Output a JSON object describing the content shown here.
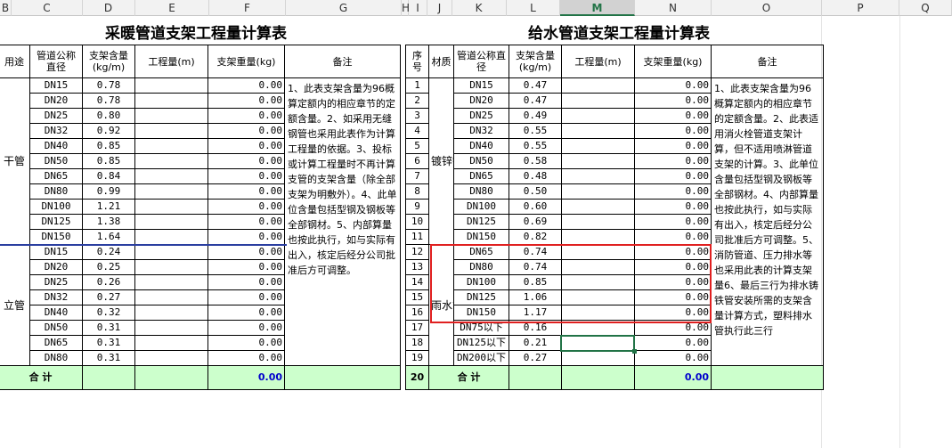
{
  "column_headers": [
    "B",
    "C",
    "D",
    "E",
    "F",
    "G",
    "H",
    "I",
    "J",
    "K",
    "L",
    "M",
    "N",
    "O",
    "P",
    "Q"
  ],
  "selected_column": "M",
  "left_table": {
    "title": "采暖管道支架工程量计算表",
    "headers": [
      "用途",
      "管道公称直径",
      "支架含量(kg/m)",
      "工程量(m)",
      "支架重量(kg)",
      "备注"
    ],
    "group1": "干管",
    "group2": "立管",
    "rows": [
      {
        "size": "DN15",
        "rate": "0.78",
        "qty": "",
        "weight": "0.00"
      },
      {
        "size": "DN20",
        "rate": "0.78",
        "qty": "",
        "weight": "0.00"
      },
      {
        "size": "DN25",
        "rate": "0.80",
        "qty": "",
        "weight": "0.00"
      },
      {
        "size": "DN32",
        "rate": "0.92",
        "qty": "",
        "weight": "0.00"
      },
      {
        "size": "DN40",
        "rate": "0.85",
        "qty": "",
        "weight": "0.00"
      },
      {
        "size": "DN50",
        "rate": "0.85",
        "qty": "",
        "weight": "0.00"
      },
      {
        "size": "DN65",
        "rate": "0.84",
        "qty": "",
        "weight": "0.00"
      },
      {
        "size": "DN80",
        "rate": "0.99",
        "qty": "",
        "weight": "0.00"
      },
      {
        "size": "DN100",
        "rate": "1.21",
        "qty": "",
        "weight": "0.00"
      },
      {
        "size": "DN125",
        "rate": "1.38",
        "qty": "",
        "weight": "0.00"
      },
      {
        "size": "DN150",
        "rate": "1.64",
        "qty": "",
        "weight": "0.00"
      },
      {
        "size": "DN15",
        "rate": "0.24",
        "qty": "",
        "weight": "0.00"
      },
      {
        "size": "DN20",
        "rate": "0.25",
        "qty": "",
        "weight": "0.00"
      },
      {
        "size": "DN25",
        "rate": "0.26",
        "qty": "",
        "weight": "0.00"
      },
      {
        "size": "DN32",
        "rate": "0.27",
        "qty": "",
        "weight": "0.00"
      },
      {
        "size": "DN40",
        "rate": "0.32",
        "qty": "",
        "weight": "0.00"
      },
      {
        "size": "DN50",
        "rate": "0.31",
        "qty": "",
        "weight": "0.00"
      },
      {
        "size": "DN65",
        "rate": "0.31",
        "qty": "",
        "weight": "0.00"
      },
      {
        "size": "DN80",
        "rate": "0.31",
        "qty": "",
        "weight": "0.00"
      }
    ],
    "notes": "1、此表支架含量为96概算定额内的相应章节的定额含量。2、如采用无缝钢管也采用此表作为计算工程量的依据。3、投标或计算工程量时不再计算支管的支架含量（除全部支架为明敷外）。4、此单位含量包括型钢及钢板等全部钢材。5、内部算量也按此执行，如与实际有出入，核定后经分公司批准后方可调整。",
    "total_label": "合    计",
    "total_value": "0.00"
  },
  "right_table": {
    "title": "给水管道支架工程量计算表",
    "headers": [
      "序号",
      "材质",
      "管道公称直径",
      "支架含量(kg/m)",
      "工程量(m)",
      "支架重量(kg)",
      "备注"
    ],
    "material1": "镀锌钢管（或其它钢管）",
    "material2": "雨水管",
    "rows": [
      {
        "no": "1",
        "size": "DN15",
        "rate": "0.47",
        "weight": "0.00"
      },
      {
        "no": "2",
        "size": "DN20",
        "rate": "0.47",
        "weight": "0.00"
      },
      {
        "no": "3",
        "size": "DN25",
        "rate": "0.49",
        "weight": "0.00"
      },
      {
        "no": "4",
        "size": "DN32",
        "rate": "0.55",
        "weight": "0.00"
      },
      {
        "no": "5",
        "size": "DN40",
        "rate": "0.55",
        "weight": "0.00"
      },
      {
        "no": "6",
        "size": "DN50",
        "rate": "0.58",
        "weight": "0.00"
      },
      {
        "no": "7",
        "size": "DN65",
        "rate": "0.48",
        "weight": "0.00"
      },
      {
        "no": "8",
        "size": "DN80",
        "rate": "0.50",
        "weight": "0.00"
      },
      {
        "no": "9",
        "size": "DN100",
        "rate": "0.60",
        "weight": "0.00"
      },
      {
        "no": "10",
        "size": "DN125",
        "rate": "0.69",
        "weight": "0.00"
      },
      {
        "no": "11",
        "size": "DN150",
        "rate": "0.82",
        "weight": "0.00"
      },
      {
        "no": "12",
        "size": "DN65",
        "rate": "0.74",
        "weight": "0.00"
      },
      {
        "no": "13",
        "size": "DN80",
        "rate": "0.74",
        "weight": "0.00"
      },
      {
        "no": "14",
        "size": "DN100",
        "rate": "0.85",
        "weight": "0.00"
      },
      {
        "no": "15",
        "size": "DN125",
        "rate": "1.06",
        "weight": "0.00"
      },
      {
        "no": "16",
        "size": "DN150",
        "rate": "1.17",
        "weight": "0.00"
      },
      {
        "no": "17",
        "size": "DN75以下",
        "rate": "0.16",
        "weight": "0.00"
      },
      {
        "no": "18",
        "size": "DN125以下",
        "rate": "0.21",
        "weight": "0.00"
      },
      {
        "no": "19",
        "size": "DN200以下",
        "rate": "0.27",
        "weight": "0.00"
      }
    ],
    "notes": "1、此表支架含量为96概算定额内的相应章节的定额含量。2、此表适用消火栓管道支架计算，但不适用喷淋管道支架的计算。3、此单位含量包括型钢及钢板等全部钢材。4、内部算量也按此执行，如与实际有出入，核定后经分公司批准后方可调整。5、消防管道、压力排水等也采用此表的计算支架量6、最后三行为排水铸铁管安装所需的支架含量计算方式，塑料排水管执行此三行",
    "total_no": "20",
    "total_label": "合    计",
    "total_value": "0.00"
  },
  "colors": {
    "total_bg": "#ccffcc",
    "highlight": "#e02020",
    "selection": "#217346",
    "value_blue": "#0000cc"
  }
}
